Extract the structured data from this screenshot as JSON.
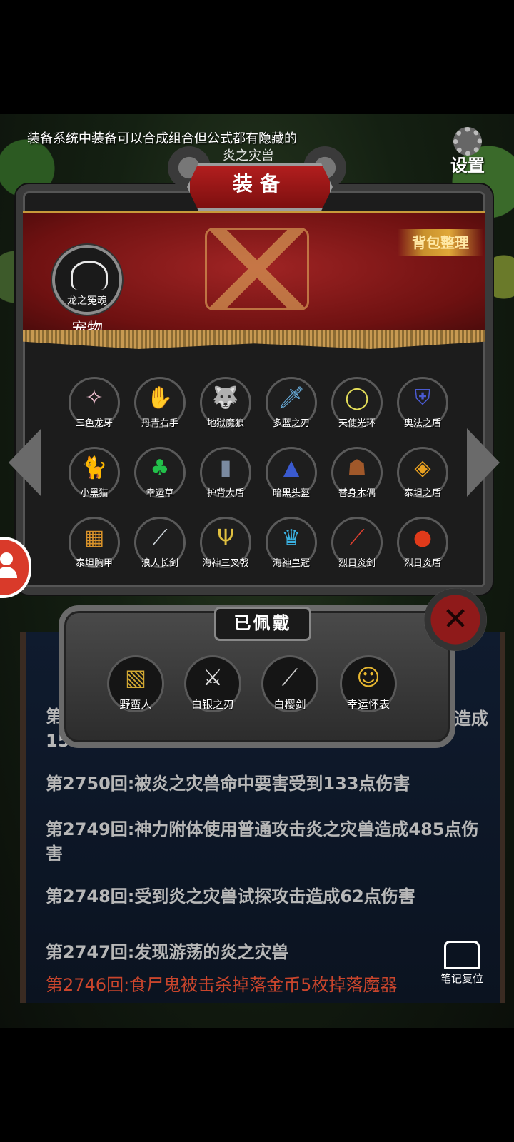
{
  "hint_text": "装备系统中装备可以合成组合但公式都有隐藏的",
  "title_behind": "炎之灾兽",
  "settings_label": "设置",
  "panel": {
    "title": "装备",
    "sort_button": "背包整理",
    "pet": {
      "name": "龙之冤魂",
      "label": "宠物"
    }
  },
  "items": [
    {
      "name": "三色龙牙",
      "icon": "tri-color-fang",
      "glyph": "✧",
      "color": "#f0c0d0"
    },
    {
      "name": "丹青右手",
      "icon": "white-glove",
      "glyph": "✋",
      "color": "#e8e8e8"
    },
    {
      "name": "地狱魔狼",
      "icon": "hell-wolf",
      "glyph": "🐺",
      "color": "#4caf3a"
    },
    {
      "name": "多蓝之刃",
      "icon": "blue-blade",
      "glyph": "🗡",
      "color": "#6ab0e0"
    },
    {
      "name": "天使光环",
      "icon": "angel-halo",
      "glyph": "◯",
      "color": "#e6e05a"
    },
    {
      "name": "奥法之盾",
      "icon": "arcane-shield",
      "glyph": "⛨",
      "color": "#4a5ad0"
    },
    {
      "name": "小黑猫",
      "icon": "black-cat",
      "glyph": "🐈",
      "color": "#cccccc"
    },
    {
      "name": "幸运草",
      "icon": "clover",
      "glyph": "♣",
      "color": "#22c04a"
    },
    {
      "name": "护背大盾",
      "icon": "tower-shield",
      "glyph": "▮",
      "color": "#7a8aa0"
    },
    {
      "name": "暗黑头盔",
      "icon": "dark-helmet",
      "glyph": "▲",
      "color": "#3a5acf"
    },
    {
      "name": "替身木偶",
      "icon": "wooden-puppet",
      "glyph": "☗",
      "color": "#a0582a"
    },
    {
      "name": "泰坦之盾",
      "icon": "titan-shield",
      "glyph": "◈",
      "color": "#e8a020"
    },
    {
      "name": "泰坦胸甲",
      "icon": "titan-chestplate",
      "glyph": "▦",
      "color": "#d8922a"
    },
    {
      "name": "浪人长剑",
      "icon": "ronin-sword",
      "glyph": "⟋",
      "color": "#cfd6dc"
    },
    {
      "name": "海神三叉戟",
      "icon": "trident",
      "glyph": "Ψ",
      "color": "#e0c040"
    },
    {
      "name": "海神皇冠",
      "icon": "sea-crown",
      "glyph": "♛",
      "color": "#3ab0e0"
    },
    {
      "name": "烈日炎剑",
      "icon": "flame-sword",
      "glyph": "⟋",
      "color": "#e04030"
    },
    {
      "name": "烈日炎盾",
      "icon": "flame-shield",
      "glyph": "●",
      "color": "#e03a1a"
    }
  ],
  "worn": {
    "title": "已佩戴",
    "items": [
      {
        "name": "野蛮人",
        "icon": "barbarian-armor",
        "glyph": "▧",
        "color": "#d2a832"
      },
      {
        "name": "白银之刃",
        "icon": "silver-blade",
        "glyph": "⚔",
        "color": "#e0e0e0"
      },
      {
        "name": "白樱剑",
        "icon": "white-sakura-sword",
        "glyph": "⟋",
        "color": "#d0d0d0"
      },
      {
        "name": "幸运怀表",
        "icon": "lucky-pocket-watch",
        "glyph": "☺",
        "color": "#e8b830"
      }
    ]
  },
  "log": {
    "hidden_line_start": "第",
    "hidden_line_end": "造成",
    "hidden_line_second": "15",
    "lines": [
      "第2750回:被炎之灾兽命中要害受到133点伤害",
      "第2749回:神力附体使用普通攻击炎之灾兽造成485点伤害",
      "第2748回:受到炎之灾兽试探攻击造成62点伤害",
      "第2747回:发现游荡的炎之灾兽"
    ],
    "red_line": "第2746回:食尸鬼被击杀掉落金币5枚掉落魔器"
  },
  "note_reset_label": "笔记复位"
}
